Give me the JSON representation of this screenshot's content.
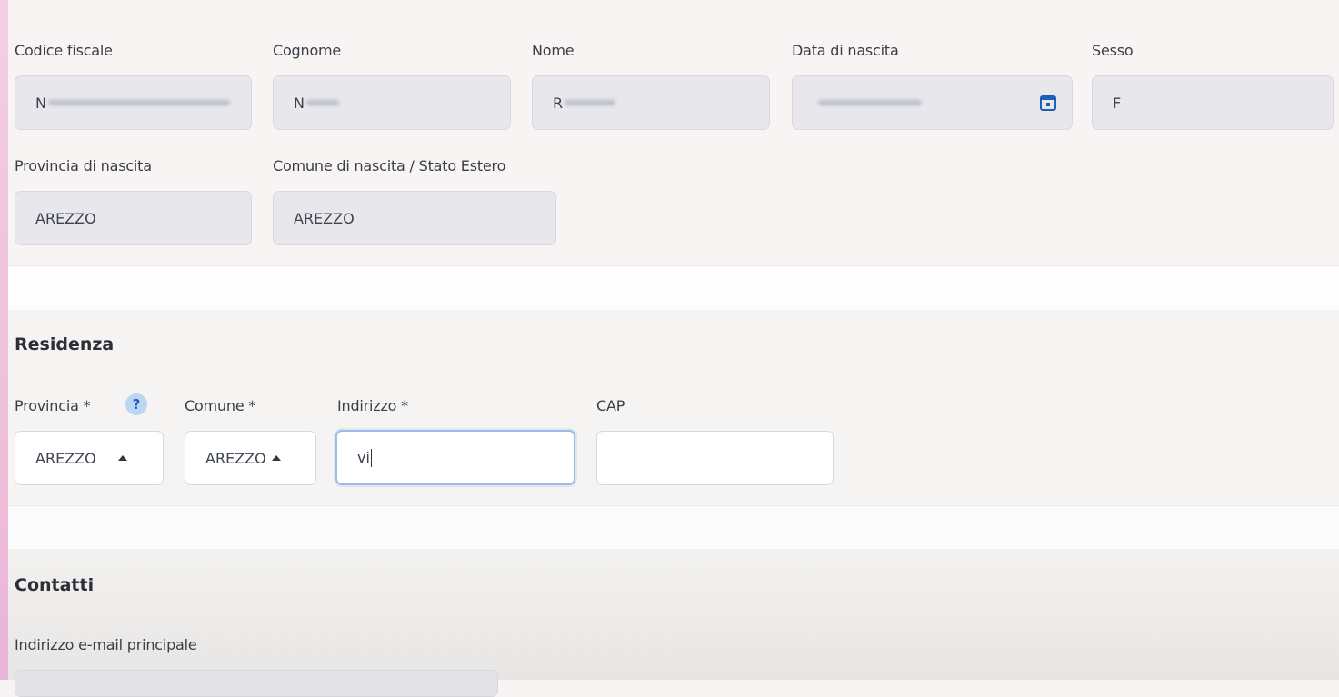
{
  "anagrafica": {
    "codice_fiscale": {
      "label": "Codice fiscale",
      "value": "N"
    },
    "cognome": {
      "label": "Cognome",
      "value": "N"
    },
    "nome": {
      "label": "Nome",
      "value": "R"
    },
    "data_nascita": {
      "label": "Data di nascita",
      "value": ""
    },
    "sesso": {
      "label": "Sesso",
      "value": "F"
    },
    "provincia_nascita": {
      "label": "Provincia di nascita",
      "value": "AREZZO"
    },
    "comune_nascita": {
      "label": "Comune di nascita / Stato Estero",
      "value": "AREZZO"
    }
  },
  "residenza": {
    "title": "Residenza",
    "provincia": {
      "label": "Provincia *",
      "value": "AREZZO",
      "help": "?"
    },
    "comune": {
      "label": "Comune *",
      "value": "AREZZO"
    },
    "indirizzo": {
      "label": "Indirizzo *",
      "value": "vi"
    },
    "cap": {
      "label": "CAP",
      "value": ""
    }
  },
  "contatti": {
    "title": "Contatti",
    "email": {
      "label": "Indirizzo e-mail principale",
      "value": ""
    }
  },
  "colors": {
    "accent_pink": "#f4cfe2",
    "help_blue": "#1f5fb5",
    "focus_border": "#9dbbe6",
    "calendar_icon": "#1f5fb5"
  },
  "icons": {
    "calendar": "calendar-icon",
    "help": "question-circle-icon",
    "dropdown": "caret-up-icon"
  }
}
